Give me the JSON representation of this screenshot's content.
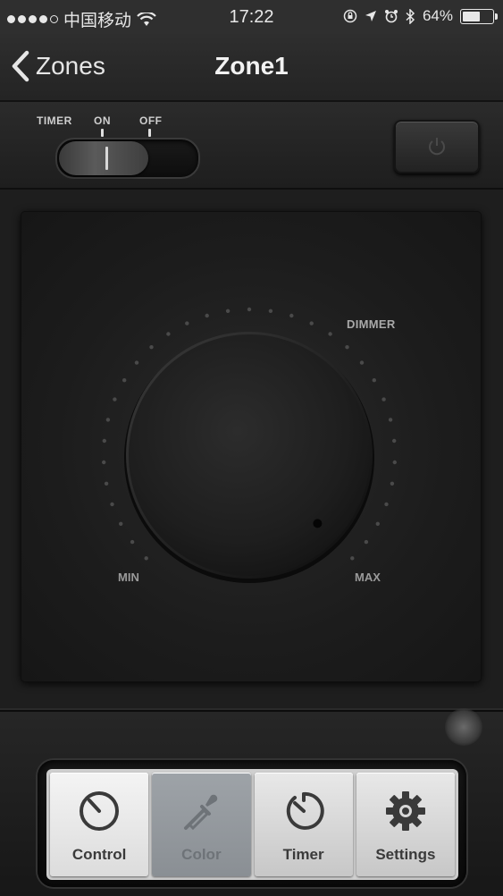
{
  "status_bar": {
    "carrier": "中国移动",
    "time": "17:22",
    "battery_percent": "64%",
    "battery_level": 0.64,
    "icons": [
      "signal-dots-icon",
      "wifi-icon",
      "orientation-lock-icon",
      "location-arrow-icon",
      "alarm-icon",
      "bluetooth-icon",
      "battery-icon"
    ]
  },
  "nav": {
    "back_label": "Zones",
    "title": "Zone1"
  },
  "timer_switch": {
    "label_timer": "TIMER",
    "label_on": "ON",
    "label_off": "OFF",
    "state": "on"
  },
  "power_button": {
    "icon": "power-icon"
  },
  "dimmer": {
    "label": "DIMMER",
    "min_label": "MIN",
    "max_label": "MAX",
    "level": 1.0
  },
  "tabs": [
    {
      "label": "Control",
      "icon": "dial-icon",
      "state": "active"
    },
    {
      "label": "Color",
      "icon": "eyedropper-icon",
      "state": "disabled"
    },
    {
      "label": "Timer",
      "icon": "stopwatch-icon",
      "state": "normal"
    },
    {
      "label": "Settings",
      "icon": "gear-icon",
      "state": "normal"
    }
  ],
  "colors": {
    "background": "#2a2a2a",
    "panel": "#1c1c1c",
    "tab_bar": "#cfcfcf",
    "text_light": "#f2f2f2"
  }
}
